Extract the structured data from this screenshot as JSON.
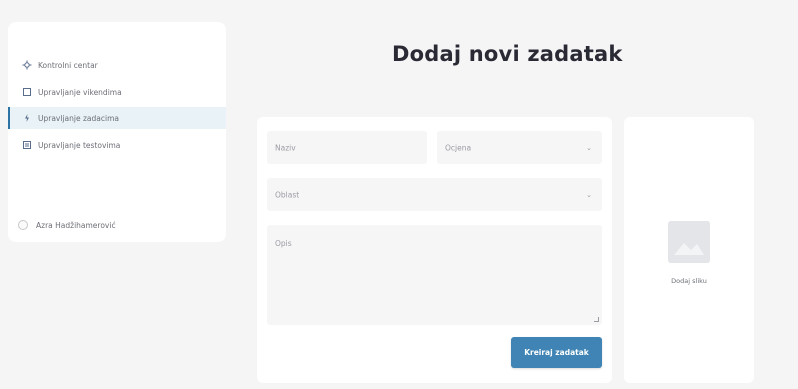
{
  "sidebar": {
    "items": [
      {
        "label": "Kontrolni centar",
        "icon": "dashboard-icon"
      },
      {
        "label": "Upravljanje vikendima",
        "icon": "calendar-icon"
      },
      {
        "label": "Upravljanje zadacima",
        "icon": "tasks-icon"
      },
      {
        "label": "Upravljanje testovima",
        "icon": "tests-icon"
      }
    ],
    "active_index": 2,
    "user": {
      "name": "Azra Hadžihamerović"
    }
  },
  "page": {
    "title": "Dodaj novi zadatak"
  },
  "form": {
    "name_placeholder": "Naziv",
    "grade_placeholder": "Ocjena",
    "area_placeholder": "Oblast",
    "description_placeholder": "Opis",
    "submit_label": "Kreiraj zadatak"
  },
  "image": {
    "add_label": "Dodaj sliku"
  },
  "colors": {
    "accent": "#3f84b4",
    "active_bg": "#e8f2f7",
    "page_bg": "#f5f5f6"
  }
}
